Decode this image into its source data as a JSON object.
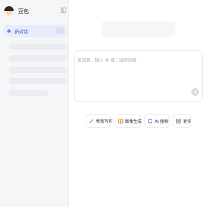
{
  "sidebar": {
    "brand_name": "豆包",
    "new_chat_label": "新对话",
    "history_placeholder_count": 6
  },
  "chat": {
    "placeholder": "发消息、输入 @ 或 / 选择技能"
  },
  "chips": [
    {
      "label": "帮我写作",
      "icon": "pen-icon"
    },
    {
      "label": "图像生成",
      "icon": "image-gen-icon"
    },
    {
      "label": "AI 搜索",
      "icon": "ai-search-icon"
    },
    {
      "label": "更多",
      "icon": "more-grid-icon"
    }
  ],
  "colors": {
    "accent": "#2f5bd6",
    "sidebar_bg": "#f5f6f8",
    "new_chat_bg": "#e9edfb"
  }
}
